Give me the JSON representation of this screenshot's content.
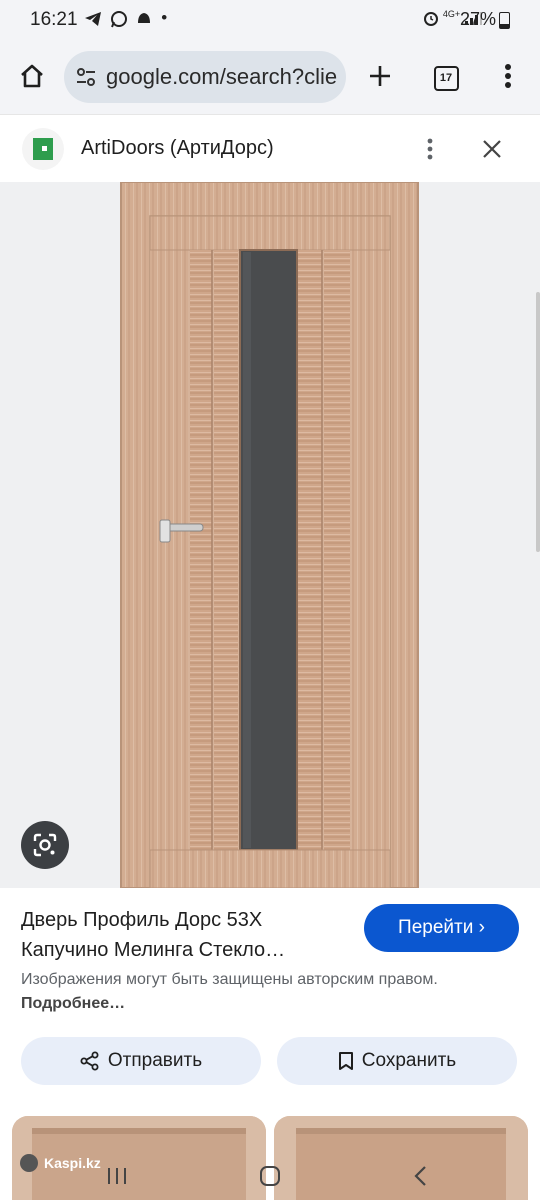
{
  "status": {
    "time": "16:21",
    "left_icons": [
      "telegram-icon",
      "whatsapp-icon",
      "notification-icon",
      "dot-icon"
    ],
    "network": "4G+",
    "battery": "27%"
  },
  "toolbar": {
    "url": "google.com/search?clie",
    "tab_count": "17"
  },
  "source": {
    "name": "ArtiDoors (АртиДорс)"
  },
  "image": {
    "alt_subject": "door",
    "colors": {
      "wood": "#d3ad92",
      "glass": "#4a4c4e",
      "background": "#eff0f2"
    }
  },
  "info": {
    "title": "Дверь Профиль Дорс 53Х Капучино Мелинга Стекло…",
    "visit_label": "Перейти ›",
    "copyright": "Изображения могут быть защищены авторским правом.",
    "more": "Подробнее…",
    "share_label": "Отправить",
    "save_label": "Сохранить"
  },
  "related": {
    "source_label": "Kaspi.kz"
  },
  "accent": "#0b57d0"
}
